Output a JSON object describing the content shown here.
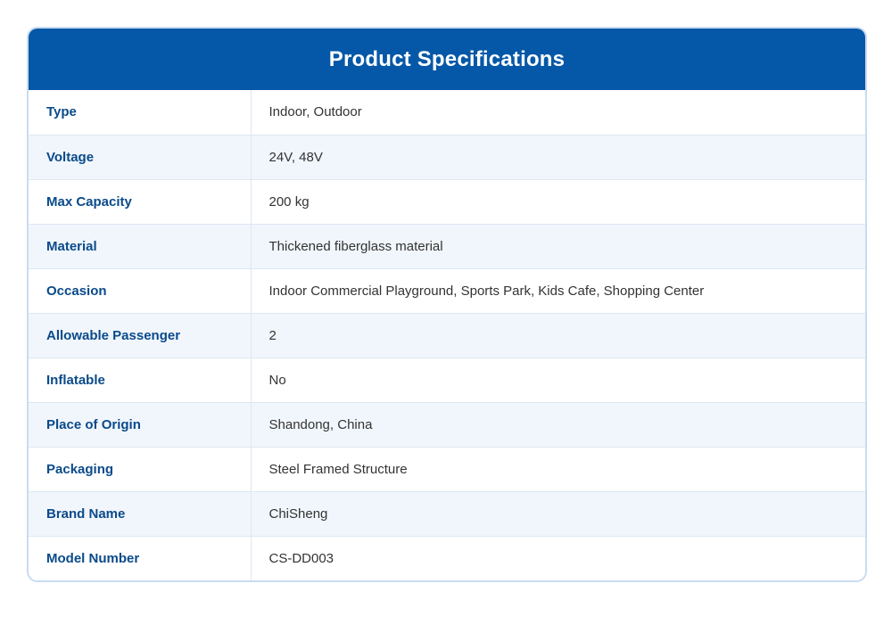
{
  "header": {
    "title": "Product Specifications"
  },
  "colors": {
    "header_bg": "#0558a7",
    "label_text": "#0a4a8a",
    "alt_row_bg": "#f1f6fc",
    "border": "#c9dcf1"
  },
  "specs": [
    {
      "label": "Type",
      "value": "Indoor, Outdoor"
    },
    {
      "label": "Voltage",
      "value": "24V, 48V"
    },
    {
      "label": "Max Capacity",
      "value": "200 kg"
    },
    {
      "label": "Material",
      "value": "Thickened fiberglass material"
    },
    {
      "label": "Occasion",
      "value": "Indoor Commercial Playground, Sports Park, Kids Cafe, Shopping Center"
    },
    {
      "label": "Allowable Passenger",
      "value": "2"
    },
    {
      "label": "Inflatable",
      "value": "No"
    },
    {
      "label": "Place of Origin",
      "value": "Shandong, China"
    },
    {
      "label": "Packaging",
      "value": "Steel Framed Structure"
    },
    {
      "label": "Brand Name",
      "value": "ChiSheng"
    },
    {
      "label": "Model Number",
      "value": "CS-DD003"
    }
  ]
}
